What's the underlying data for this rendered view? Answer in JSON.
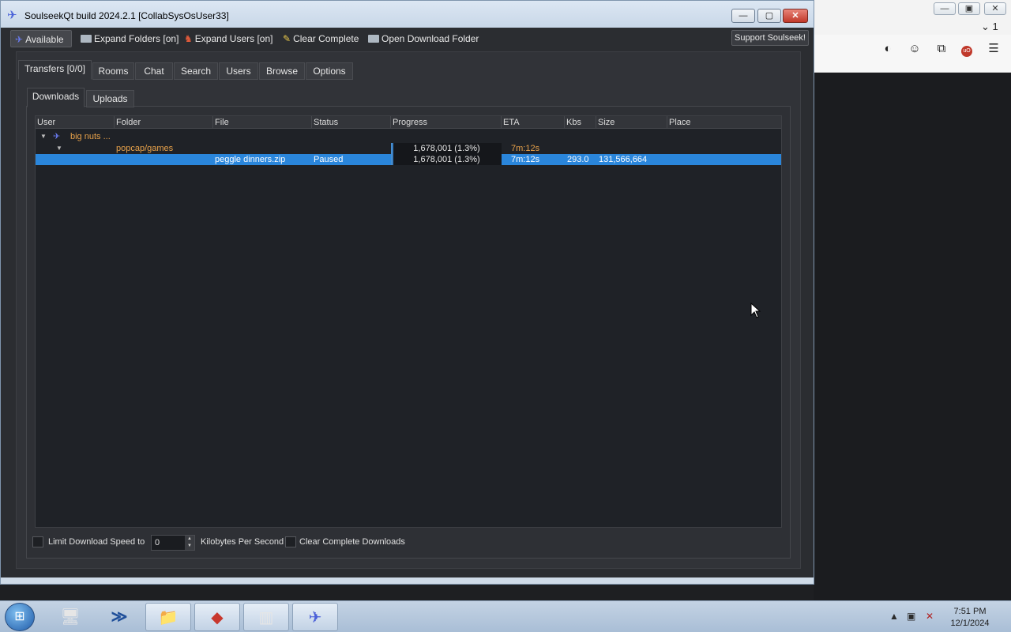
{
  "window": {
    "title": "SoulseekQt build 2024.2.1 [CollabSysOsUser33]",
    "min_label": "—",
    "max_label": "▢",
    "close_label": "✕"
  },
  "toolbar": {
    "status": "Available",
    "expand_folders": "Expand Folders [on]",
    "expand_users": "Expand Users [on]",
    "clear_complete": "Clear Complete",
    "open_download_folder": "Open Download Folder",
    "support": "Support Soulseek!"
  },
  "main_tabs": [
    "Transfers [0/0]",
    "Rooms",
    "Chat",
    "Search",
    "Users",
    "Browse",
    "Options"
  ],
  "sub_tabs": [
    "Downloads",
    "Uploads"
  ],
  "table": {
    "headers": [
      "User",
      "Folder",
      "File",
      "Status",
      "Progress",
      "ETA",
      "Kbs",
      "Size",
      "Place"
    ],
    "user_row": {
      "user": "big nuts ..."
    },
    "folder_row": {
      "folder": "popcap/games",
      "progress": "1,678,001 (1.3%)",
      "progress_fraction": 0.013,
      "eta": "7m:12s"
    },
    "file_row": {
      "file": "peggle dinners.zip",
      "status": "Paused",
      "progress": "1,678,001 (1.3%)",
      "progress_fraction": 0.013,
      "eta": "7m:12s",
      "kbs": "293.0",
      "size": "131,566,664",
      "place": ""
    }
  },
  "bottom": {
    "limit_label": "Limit Download Speed to",
    "speed_value": "0",
    "unit_label": "Kilobytes Per Second",
    "clear_label": "Clear Complete Downloads"
  },
  "browser": {
    "tab_count": "1"
  },
  "taskbar": {
    "time": "7:51 PM",
    "date": "12/1/2024"
  },
  "colors": {
    "selection": "#2a86db",
    "accent_text": "#e8a24a",
    "background": "#2b2d31"
  }
}
